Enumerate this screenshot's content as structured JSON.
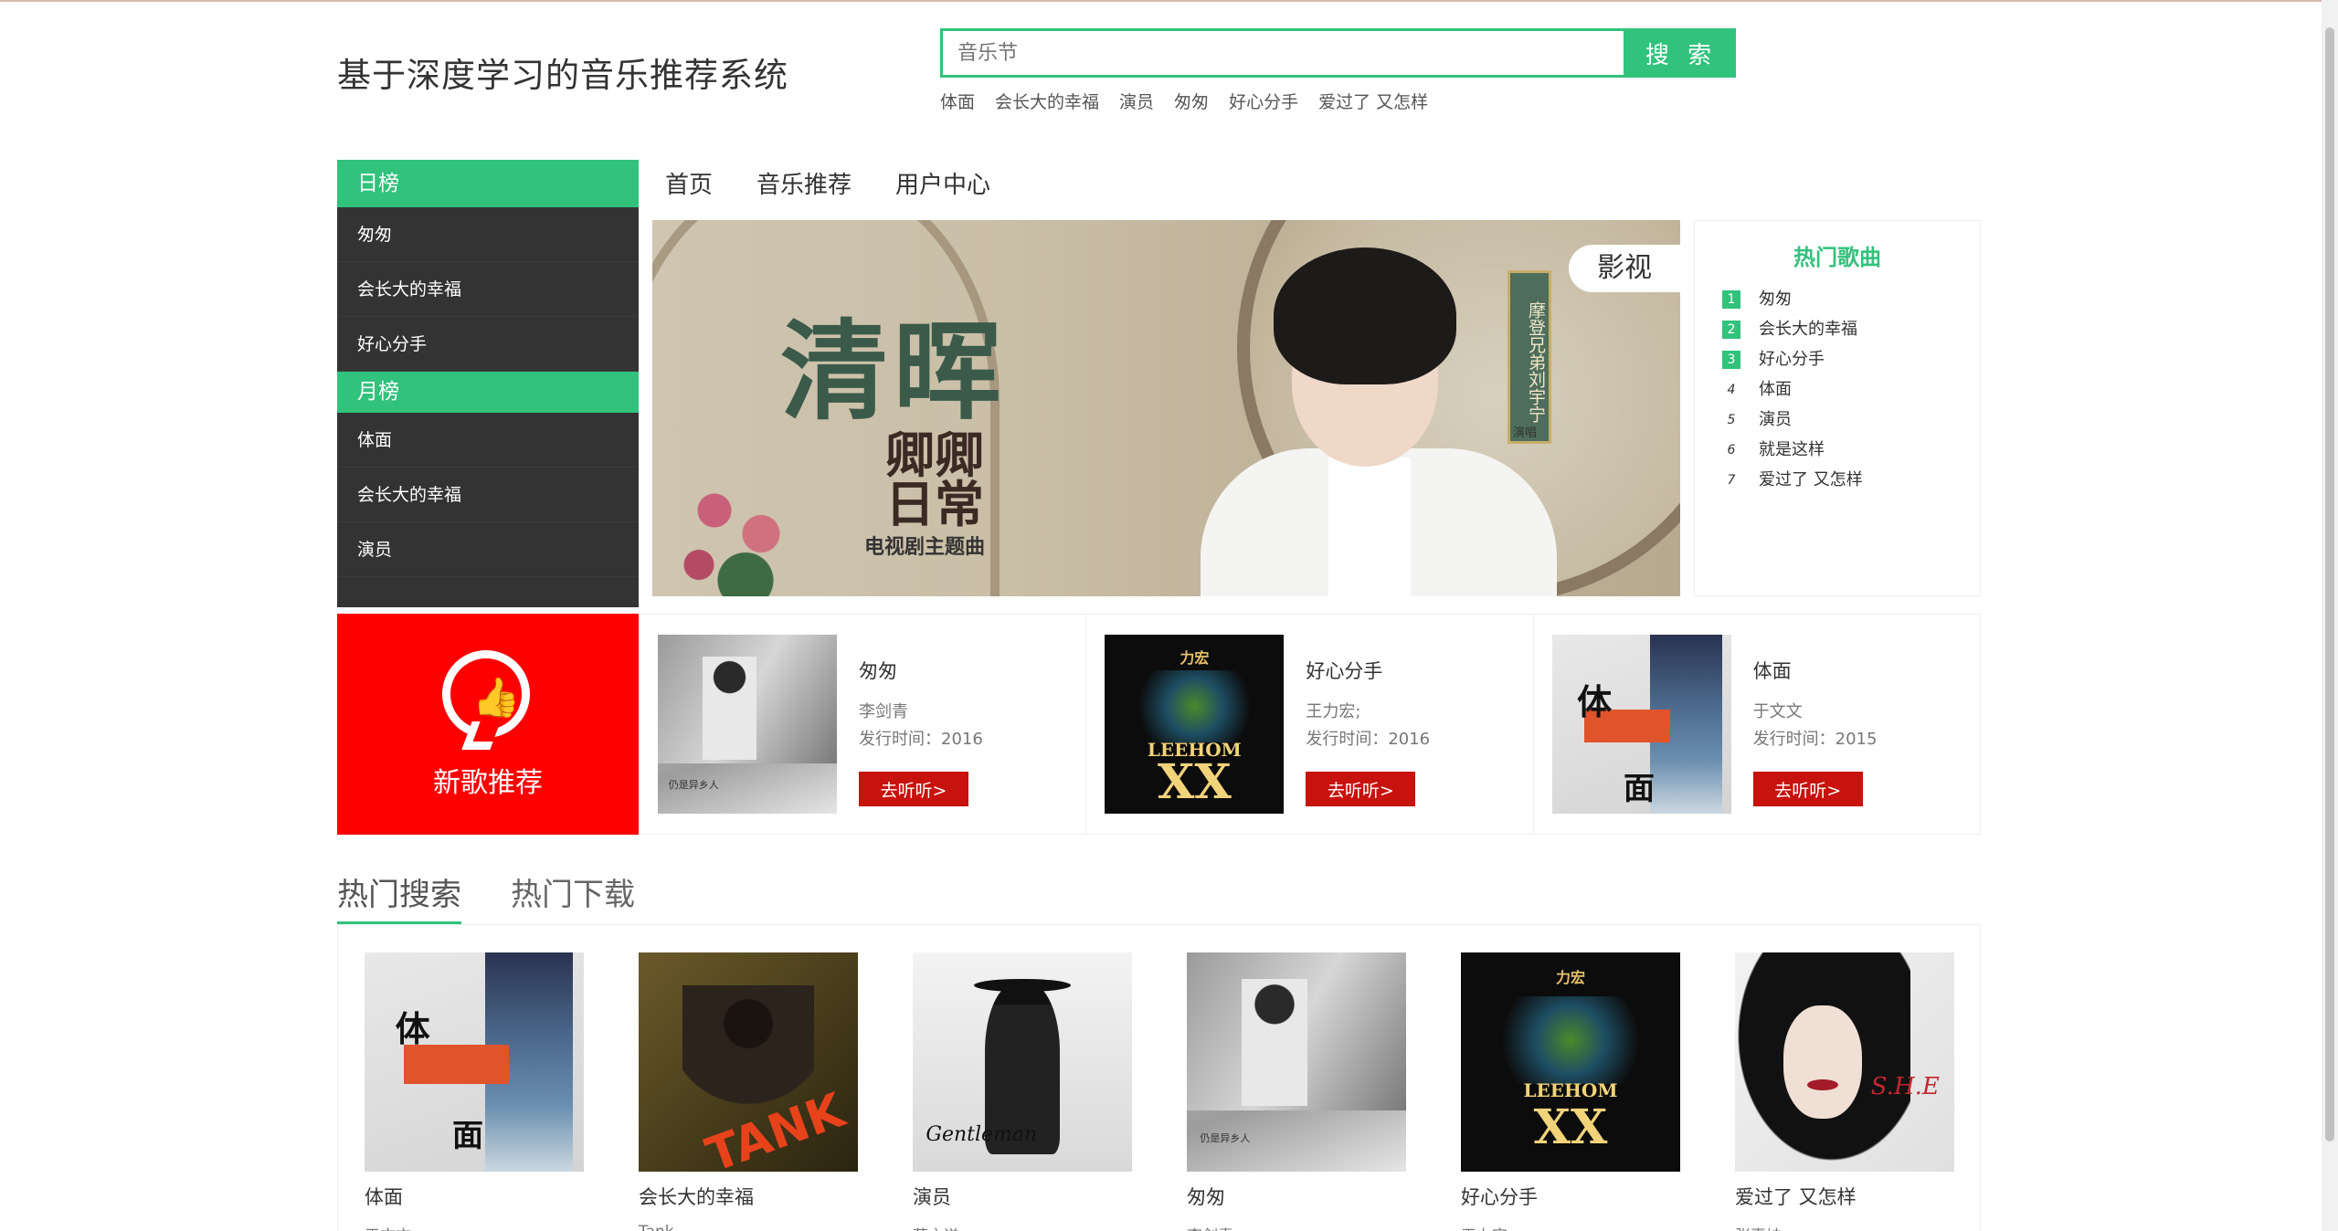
{
  "header": {
    "site_title": "基于深度学习的音乐推荐系统",
    "search_placeholder": "音乐节",
    "search_button": "搜 索",
    "hot_keywords": [
      "体面",
      "会长大的幸福",
      "演员",
      "匆匆",
      "好心分手",
      "爱过了 又怎样"
    ]
  },
  "nav": {
    "items": [
      "首页",
      "音乐推荐",
      "用户中心"
    ]
  },
  "rank": {
    "daily_title": "日榜",
    "daily_items": [
      "匆匆",
      "会长大的幸福",
      "好心分手"
    ],
    "monthly_title": "月榜",
    "monthly_items": [
      "体面",
      "会长大的幸福",
      "演员"
    ]
  },
  "banner": {
    "title": "清晖",
    "subtitle_logo": "卿卿日常",
    "theme": "电视剧主题曲",
    "singer_vertical": "摩登兄弟刘宇宁",
    "singer_role": "演唱",
    "tag": "影视"
  },
  "hot_songs": {
    "title": "热门歌曲",
    "items": [
      {
        "rank": "1",
        "name": "匆匆"
      },
      {
        "rank": "2",
        "name": "会长大的幸福"
      },
      {
        "rank": "3",
        "name": "好心分手"
      },
      {
        "rank": "4",
        "name": "体面"
      },
      {
        "rank": "5",
        "name": "演员"
      },
      {
        "rank": "6",
        "name": "就是这样"
      },
      {
        "rank": "7",
        "name": "爱过了 又怎样"
      }
    ]
  },
  "new_songs": {
    "label": "新歌推荐",
    "items": [
      {
        "name": "匆匆",
        "singer": "李剑青",
        "date": "发行时间：2016",
        "button": "去听听>",
        "art": "cong",
        "art_caption": "仍是异乡人"
      },
      {
        "name": "好心分手",
        "singer": "王力宏;",
        "date": "发行时间：2016",
        "button": "去听听>",
        "art": "lh",
        "art_top": "力宏",
        "art_brand": "LEEHOM",
        "art_xx": "XX"
      },
      {
        "name": "体面",
        "singer": "于文文",
        "date": "发行时间：2015",
        "button": "去听听>",
        "art": "timian",
        "art_t1": "体",
        "art_t2": "面"
      }
    ]
  },
  "tabs": {
    "hot_search": "热门搜索",
    "hot_download": "热门下载"
  },
  "hot_grid": {
    "items": [
      {
        "name": "体面",
        "singer": "于文文",
        "art": "timian",
        "art_t1": "体",
        "art_t2": "面"
      },
      {
        "name": "会长大的幸福",
        "singer": "Tank",
        "art": "tank",
        "art_word": "TANK"
      },
      {
        "name": "演员",
        "singer": "薛之谦",
        "art": "yy",
        "art_sig": "Gentleman"
      },
      {
        "name": "匆匆",
        "singer": "李剑青",
        "art": "cong",
        "art_caption": "仍是异乡人"
      },
      {
        "name": "好心分手",
        "singer": "王力宏",
        "art": "lh",
        "art_top": "力宏",
        "art_brand": "LEEHOM",
        "art_xx": "XX"
      },
      {
        "name": "爱过了 又怎样",
        "singer": "张惠妹",
        "art": "sj",
        "art_sign": "S.H.E"
      }
    ]
  },
  "colors": {
    "accent": "#31c27c",
    "sidebar_bg": "#333333",
    "new_rec_bg": "#ff0000",
    "listen_button": "#c7120d"
  }
}
